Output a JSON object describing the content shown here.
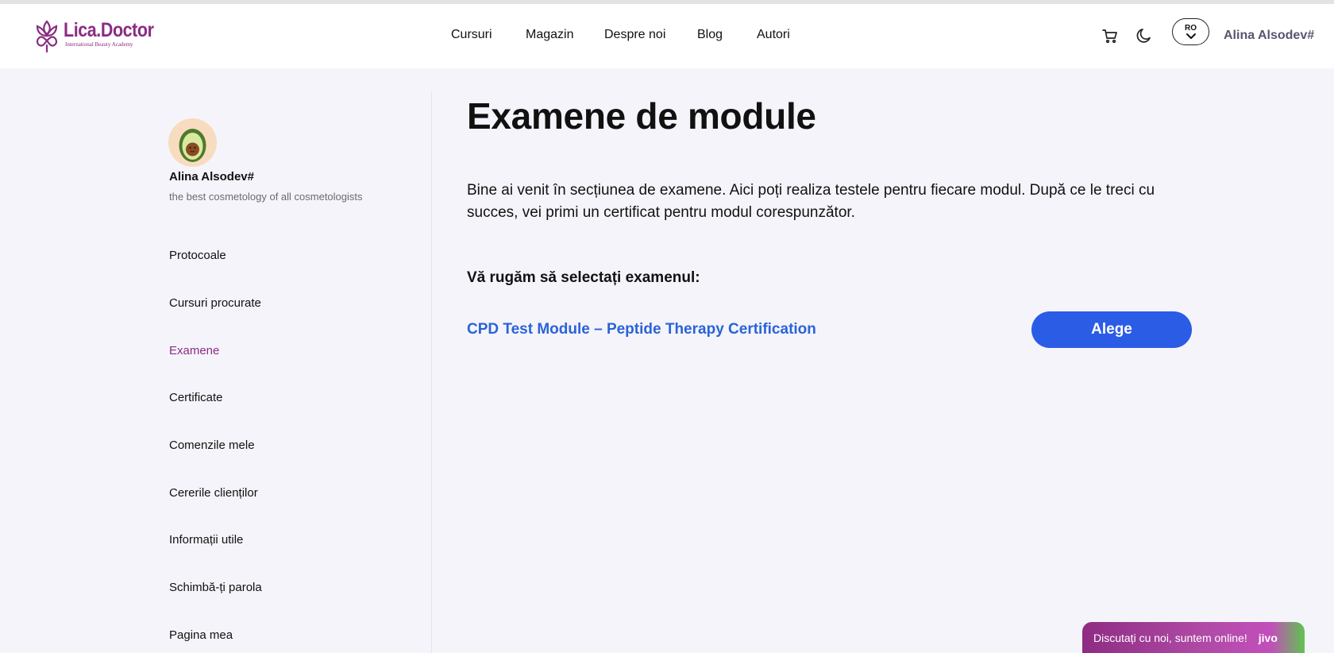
{
  "header": {
    "logo_name": "Lica.Doctor",
    "logo_tagline": "International Beauty Academy",
    "nav": [
      "Cursuri",
      "Magazin",
      "Despre noi",
      "Blog",
      "Autori"
    ],
    "language": "RO",
    "user_name": "Alina Alsodev#",
    "icons": [
      "cart-icon",
      "moon-icon",
      "chevron-down-icon"
    ]
  },
  "sidebar": {
    "profile_name": "Alina Alsodev#",
    "profile_bio": "the best cosmetology of all cosmetologists",
    "items": [
      {
        "label": "Protocoale"
      },
      {
        "label": "Cursuri procurate"
      },
      {
        "label": "Examene",
        "active": true
      },
      {
        "label": "Certificate"
      },
      {
        "label": "Comenzile mele"
      },
      {
        "label": "Cererile clienților"
      },
      {
        "label": "Informații utile"
      },
      {
        "label": "Schimbă-ți parola"
      },
      {
        "label": "Pagina mea"
      }
    ]
  },
  "main": {
    "title": "Examene de module",
    "intro": "Bine ai venit în secțiunea de examene. Aici poți realiza testele pentru fiecare modul. După ce le treci cu succes, vei primi un certificat pentru modul corespunzător.",
    "prompt": "Vă rugăm să selectați examenul:",
    "exam_title": "CPD Test Module – Peptide Therapy Certification",
    "choose_label": "Alege"
  },
  "chat": {
    "text": "Discutați cu noi, suntem online!",
    "brand": "jivo"
  },
  "colors": {
    "brand": "#8a2c82",
    "link": "#2a63d8",
    "button": "#2b5ce6",
    "page_bg": "#f5f4fb"
  }
}
